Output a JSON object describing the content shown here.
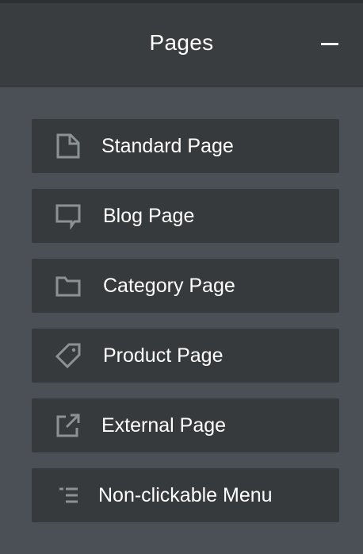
{
  "panel": {
    "title": "Pages",
    "collapse_icon": "minus-icon"
  },
  "items": [
    {
      "label": "Standard Page",
      "icon": "document-icon"
    },
    {
      "label": "Blog Page",
      "icon": "speech-bubble-icon"
    },
    {
      "label": "Category Page",
      "icon": "folder-icon"
    },
    {
      "label": "Product Page",
      "icon": "tag-icon"
    },
    {
      "label": "External Page",
      "icon": "external-link-icon"
    },
    {
      "label": "Non-clickable Menu",
      "icon": "menu-list-icon"
    }
  ],
  "colors": {
    "header_background": "#393d40",
    "panel_background": "#4a5055",
    "item_background": "#363a3d",
    "icon_color": "#8c9194",
    "text_color": "#ffffff"
  }
}
